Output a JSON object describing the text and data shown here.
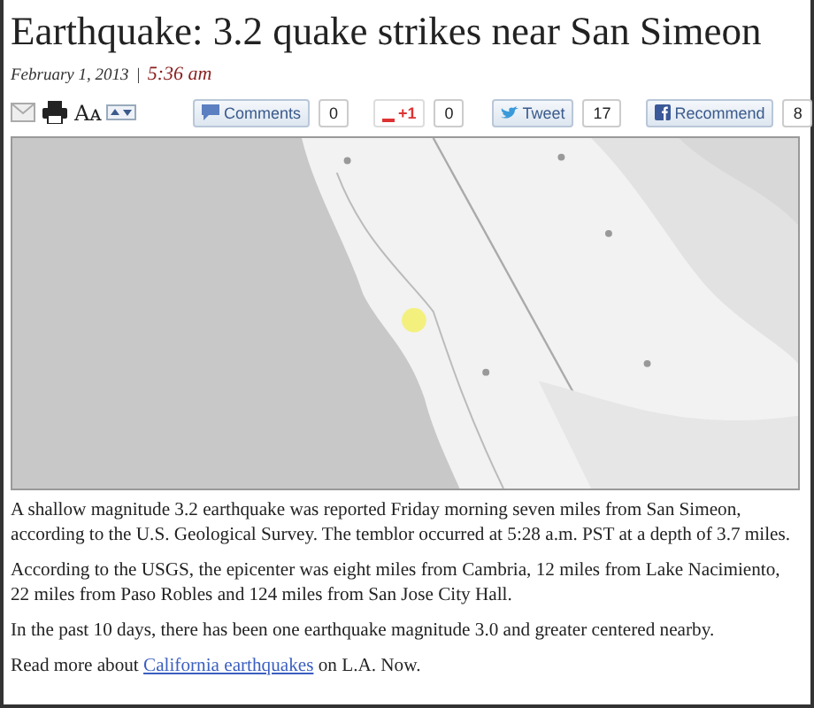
{
  "headline": "Earthquake: 3.2 quake strikes near San Simeon",
  "dateline": {
    "date": "February 1, 2013",
    "separator": "|",
    "time": "5:36 am"
  },
  "toolbar": {
    "font_size_label": "Aᴀ",
    "share_buttons": [
      {
        "kind": "comments",
        "label": "Comments",
        "count": "0"
      },
      {
        "kind": "gplus",
        "label": "+1",
        "count": "0"
      },
      {
        "kind": "tweet",
        "label": "Tweet",
        "count": "17"
      },
      {
        "kind": "facebook",
        "label": "Recommend",
        "count": "8"
      }
    ]
  },
  "paragraphs": [
    {
      "text": "A shallow magnitude 3.2 earthquake was reported Friday morning seven miles from San Simeon, according to the U.S. Geological Survey. The temblor occurred at 5:28 a.m. PST at a depth of 3.7 miles."
    },
    {
      "text": "According to the USGS, the epicenter was eight miles from Cambria, 12 miles from Lake Nacimiento, 22 miles from Paso Robles and 124 miles from San Jose City Hall."
    },
    {
      "text": "In the past 10 days, there has been one earthquake magnitude 3.0 and greater centered nearby."
    },
    {
      "before": "Read more about ",
      "link": "California earthquakes",
      "after": " on L.A. Now."
    }
  ]
}
